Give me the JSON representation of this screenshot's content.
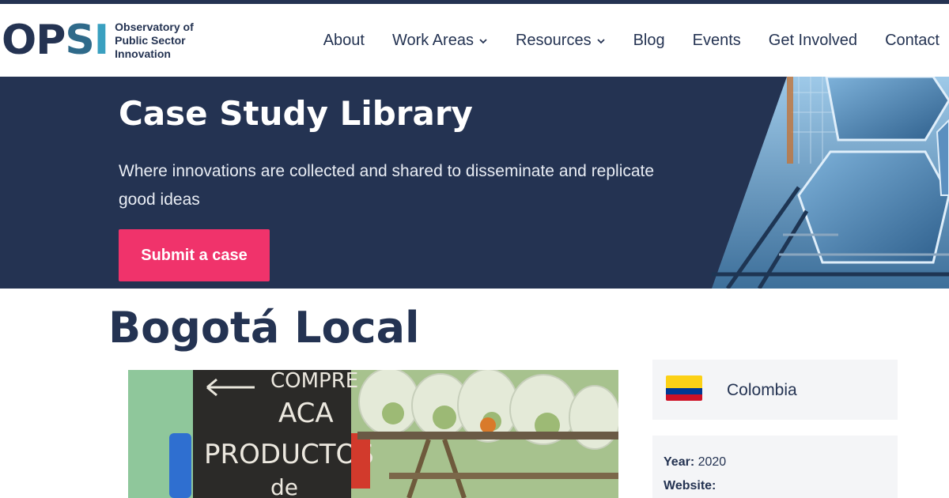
{
  "logo": {
    "mark": {
      "o": "O",
      "p": "P",
      "s": "S",
      "i": "I"
    },
    "text": "Observatory of Public Sector Innovation"
  },
  "nav": {
    "items": [
      {
        "label": "About"
      },
      {
        "label": "Work Areas"
      },
      {
        "label": "Resources"
      },
      {
        "label": "Blog"
      },
      {
        "label": "Events"
      },
      {
        "label": "Get Involved"
      },
      {
        "label": "Contact"
      }
    ]
  },
  "hero": {
    "title": "Case Study Library",
    "subtitle": "Where innovations are collected and shared to disseminate and replicate good ideas",
    "cta_label": "Submit a case"
  },
  "case": {
    "title": "Bogotá Local",
    "photo_sign": [
      "COMPRE",
      "ACA",
      "PRODUCTOS",
      "de"
    ],
    "country": "Colombia",
    "year_label": "Year:",
    "year_value": "2020",
    "website_label": "Website:"
  },
  "colors": {
    "navy": "#243352",
    "accent_pink": "#f0336b",
    "logo_teal": "#3aa0c0"
  }
}
